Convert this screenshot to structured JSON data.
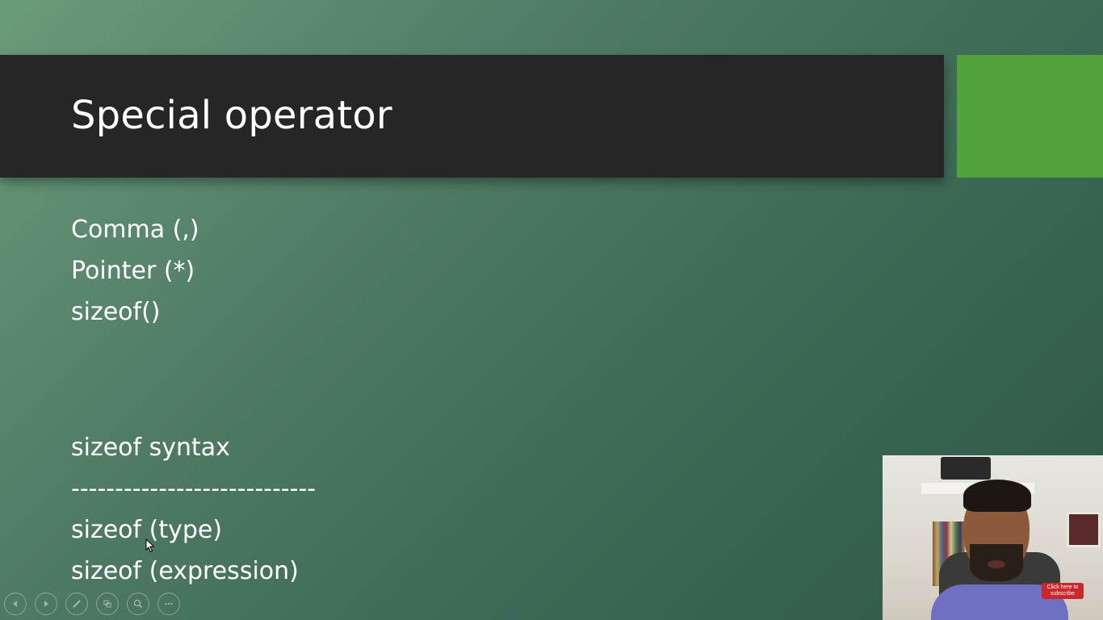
{
  "slide": {
    "title": "Special operator",
    "lines": [
      "Comma (,)",
      "Pointer (*)",
      "sizeof()",
      "sizeof syntax",
      "----------------------------",
      "sizeof (type)",
      "sizeof (expression)"
    ]
  },
  "colors": {
    "title_band": "#262626",
    "accent_block": "#51a23d",
    "background": "#4f7a64",
    "text": "#ffffff",
    "subscribe_button": "#c8282b"
  },
  "controls": [
    {
      "name": "previous-slide-icon"
    },
    {
      "name": "next-slide-icon"
    },
    {
      "name": "pen-icon"
    },
    {
      "name": "see-all-slides-icon"
    },
    {
      "name": "zoom-icon"
    },
    {
      "name": "more-options-icon"
    }
  ],
  "webcam": {
    "subscribe_label": "Click here to subscribe"
  }
}
